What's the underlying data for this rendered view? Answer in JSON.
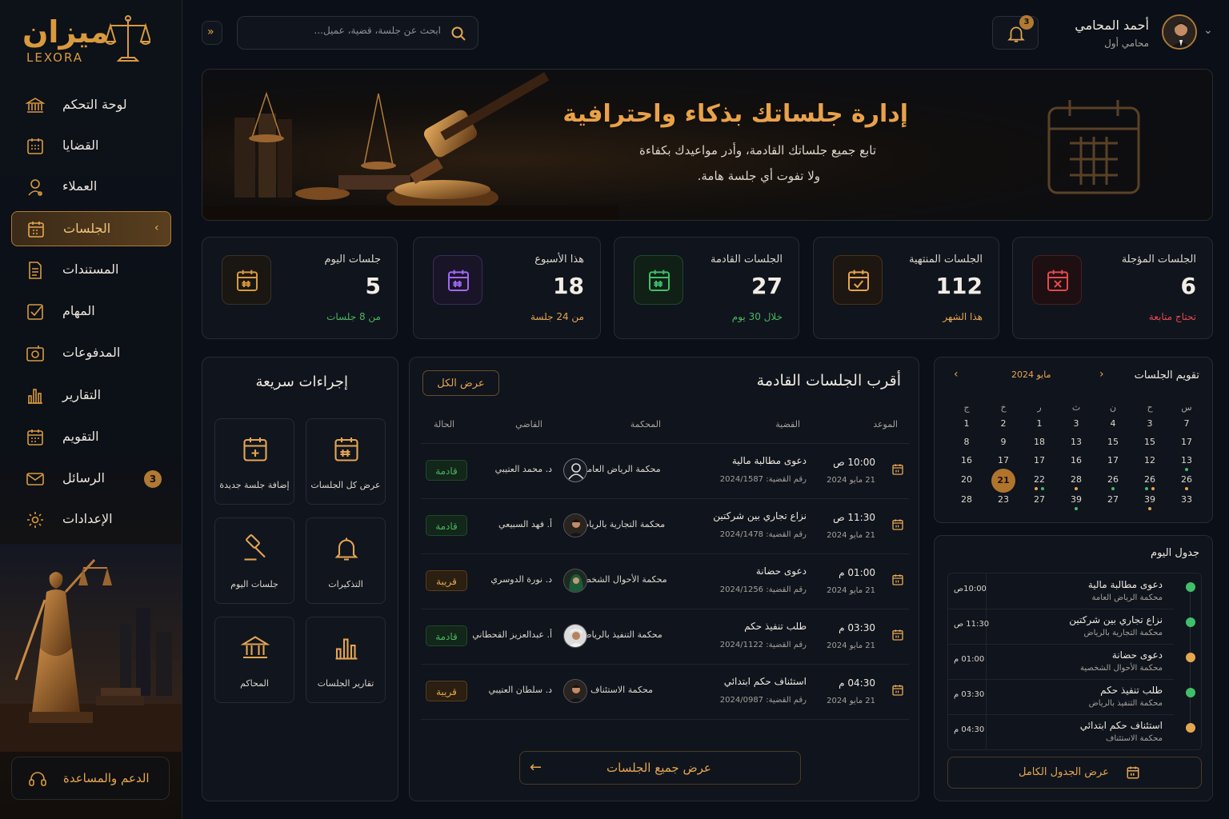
{
  "brand": {
    "name_ar": "ميزان",
    "name_en": "LEXORA"
  },
  "sidebar": {
    "items": [
      {
        "label": "لوحة التحكم",
        "icon": "bank-icon"
      },
      {
        "label": "القضايا",
        "icon": "calendar-grid-icon"
      },
      {
        "label": "العملاء",
        "icon": "user-icon"
      },
      {
        "label": "الجلسات",
        "icon": "calendar-icon",
        "active": true
      },
      {
        "label": "المستندات",
        "icon": "document-icon"
      },
      {
        "label": "المهام",
        "icon": "checklist-icon"
      },
      {
        "label": "المدفوعات",
        "icon": "payment-icon"
      },
      {
        "label": "التقارير",
        "icon": "bar-chart-icon"
      },
      {
        "label": "التقويم",
        "icon": "calendar-icon"
      },
      {
        "label": "الرسائل",
        "icon": "mail-icon",
        "badge": "3"
      },
      {
        "label": "الإعدادات",
        "icon": "gear-icon"
      }
    ],
    "support": "الدعم والمساعدة"
  },
  "topbar": {
    "search_placeholder": "ابحث عن جلسة، قضية، عميل...",
    "notifications": "3",
    "user_name": "أحمد المحامي",
    "user_role": "محامي أول"
  },
  "hero": {
    "title": "إدارة جلساتك بذكاء واحترافية",
    "line1": "تابع جميع جلساتك القادمة، وأدر مواعيدك بكفاءة",
    "line2": "ولا تفوت أي جلسة هامة."
  },
  "stats": [
    {
      "title": "جلسات اليوم",
      "value": "5",
      "sub": "من 8 جلسات",
      "sub_color": "#4bb55c",
      "accent": "#d99a3e"
    },
    {
      "title": "هذا الأسبوع",
      "value": "18",
      "sub": "من 24 جلسة",
      "sub_color": "#e5a650",
      "accent": "#9a5cf0"
    },
    {
      "title": "الجلسات القادمة",
      "value": "27",
      "sub": "خلال 30 يوم",
      "sub_color": "#4bb55c",
      "accent": "#3fbf6a"
    },
    {
      "title": "الجلسات المنتهية",
      "value": "112",
      "sub": "هذا الشهر",
      "sub_color": "#e5a650",
      "accent": "#e5a650"
    },
    {
      "title": "الجلسات المؤجلة",
      "value": "6",
      "sub": "تحتاج متابعة",
      "sub_color": "#e5484d",
      "accent": "#e5484d"
    }
  ],
  "quick": {
    "title": "إجراءات سريعة",
    "actions": [
      {
        "label": "عرض كل الجلسات",
        "icon": "calendar-grid-icon"
      },
      {
        "label": "إضافة جلسة جديدة",
        "icon": "calendar-plus-icon"
      },
      {
        "label": "التذكيرات",
        "icon": "bell-icon"
      },
      {
        "label": "جلسات اليوم",
        "icon": "gavel-icon"
      },
      {
        "label": "تقارير الجلسات",
        "icon": "bar-chart-icon"
      },
      {
        "label": "المحاكم",
        "icon": "courthouse-icon"
      }
    ]
  },
  "upcoming": {
    "title": "أقرب الجلسات القادمة",
    "view_all": "عرض الكل",
    "columns": {
      "time": "الموعد",
      "case": "القضية",
      "court": "المحكمة",
      "judge": "القاضي",
      "status": "الحالة"
    },
    "rows": [
      {
        "time": "10:00 ص",
        "date": "21 مايو 2024",
        "case": "دعوى مطالبة مالية",
        "case_no": "رقم القضية: 2024/1587",
        "court": "محكمة الرياض العامة",
        "judge": "د. محمد العتيبي",
        "status": "قادمة",
        "status_type": "green"
      },
      {
        "time": "11:30 ص",
        "date": "21 مايو 2024",
        "case": "نزاع تجاري بين شركتين",
        "case_no": "رقم القضية: 2024/1478",
        "court": "محكمة التجارية بالرياض",
        "judge": "أ. فهد السبيعي",
        "status": "قادمة",
        "status_type": "green"
      },
      {
        "time": "01:00 م",
        "date": "21 مايو 2024",
        "case": "دعوى حضانة",
        "case_no": "رقم القضية: 2024/1256",
        "court": "محكمة الأحوال الشخصية",
        "judge": "د. نورة الدوسري",
        "status": "قريبة",
        "status_type": "orange"
      },
      {
        "time": "03:30 م",
        "date": "21 مايو 2024",
        "case": "طلب تنفيذ حكم",
        "case_no": "رقم القضية: 2024/1122",
        "court": "محكمة التنفيذ بالرياض",
        "judge": "أ. عبدالعزيز القحطاني",
        "status": "قادمة",
        "status_type": "green"
      },
      {
        "time": "04:30 م",
        "date": "21 مايو 2024",
        "case": "استئناف حكم ابتدائي",
        "case_no": "رقم القضية: 2024/0987",
        "court": "محكمة الاستئناف",
        "judge": "د. سلطان العتيبي",
        "status": "قريبة",
        "status_type": "orange"
      }
    ],
    "view_all_sessions": "عرض جميع الجلسات"
  },
  "calendar": {
    "title": "تقويم الجلسات",
    "month": "مايو 2024",
    "day_headers": [
      "س",
      "ح",
      "ن",
      "ث",
      "ر",
      "خ",
      "ج"
    ],
    "weeks": [
      [
        "7",
        "3",
        "4",
        "3",
        "1",
        "2",
        "1"
      ],
      [
        "17",
        "15",
        "15",
        "13",
        "18",
        "9",
        "8"
      ],
      [
        "13",
        "12",
        "17",
        "16",
        "17",
        "17",
        "16"
      ],
      [
        "26",
        "26",
        "26",
        "28",
        "22",
        "21",
        "20"
      ],
      [
        "33",
        "39",
        "27",
        "39",
        "27",
        "23",
        "28"
      ]
    ],
    "today": "21"
  },
  "today": {
    "title": "جدول اليوم",
    "items": [
      {
        "case": "دعوى مطالبة مالية",
        "court": "محكمة الرياض العامة",
        "time": "10:00ص",
        "color": "#3fbf6a"
      },
      {
        "case": "نزاع تجاري بين شركتين",
        "court": "محكمة التجارية بالرياض",
        "time": "11:30 ص",
        "color": "#3fbf6a"
      },
      {
        "case": "دعوى حضانة",
        "court": "محكمة الأحوال الشخصية",
        "time": "01:00 م",
        "color": "#e5a650"
      },
      {
        "case": "طلب تنفيذ حكم",
        "court": "محكمة التنفيذ بالرياض",
        "time": "03:30 م",
        "color": "#3fbf6a"
      },
      {
        "case": "استئناف حكم ابتدائي",
        "court": "محكمة الاستئناف",
        "time": "04:30 م",
        "color": "#e5a650"
      }
    ],
    "full_button": "عرض الجدول الكامل"
  }
}
